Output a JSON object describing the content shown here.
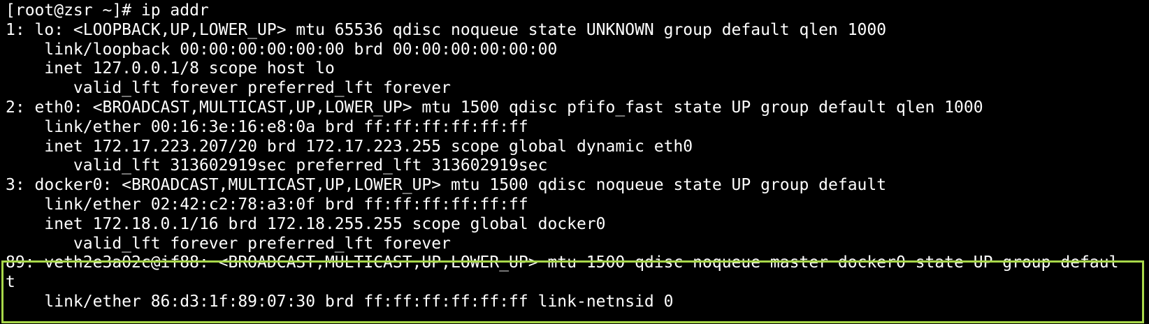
{
  "terminal": {
    "prompt": "[root@zsr ~]# ip addr",
    "lines": [
      "1: lo: <LOOPBACK,UP,LOWER_UP> mtu 65536 qdisc noqueue state UNKNOWN group default qlen 1000",
      "    link/loopback 00:00:00:00:00:00 brd 00:00:00:00:00:00",
      "    inet 127.0.0.1/8 scope host lo",
      "       valid_lft forever preferred_lft forever",
      "2: eth0: <BROADCAST,MULTICAST,UP,LOWER_UP> mtu 1500 qdisc pfifo_fast state UP group default qlen 1000",
      "    link/ether 00:16:3e:16:e8:0a brd ff:ff:ff:ff:ff:ff",
      "    inet 172.17.223.207/20 brd 172.17.223.255 scope global dynamic eth0",
      "       valid_lft 313602919sec preferred_lft 313602919sec",
      "3: docker0: <BROADCAST,MULTICAST,UP,LOWER_UP> mtu 1500 qdisc noqueue state UP group default",
      "    link/ether 02:42:c2:78:a3:0f brd ff:ff:ff:ff:ff:ff",
      "    inet 172.18.0.1/16 brd 172.18.255.255 scope global docker0",
      "       valid_lft forever preferred_lft forever",
      "89: veth2e3a02c@if88: <BROADCAST,MULTICAST,UP,LOWER_UP> mtu 1500 qdisc noqueue master docker0 state UP group defaul",
      "t",
      "    link/ether 86:d3:1f:89:07:30 brd ff:ff:ff:ff:ff:ff link-netnsid 0"
    ]
  },
  "colors": {
    "background": "#000000",
    "text": "#ffffff",
    "highlight_border": "#a8d84a"
  }
}
